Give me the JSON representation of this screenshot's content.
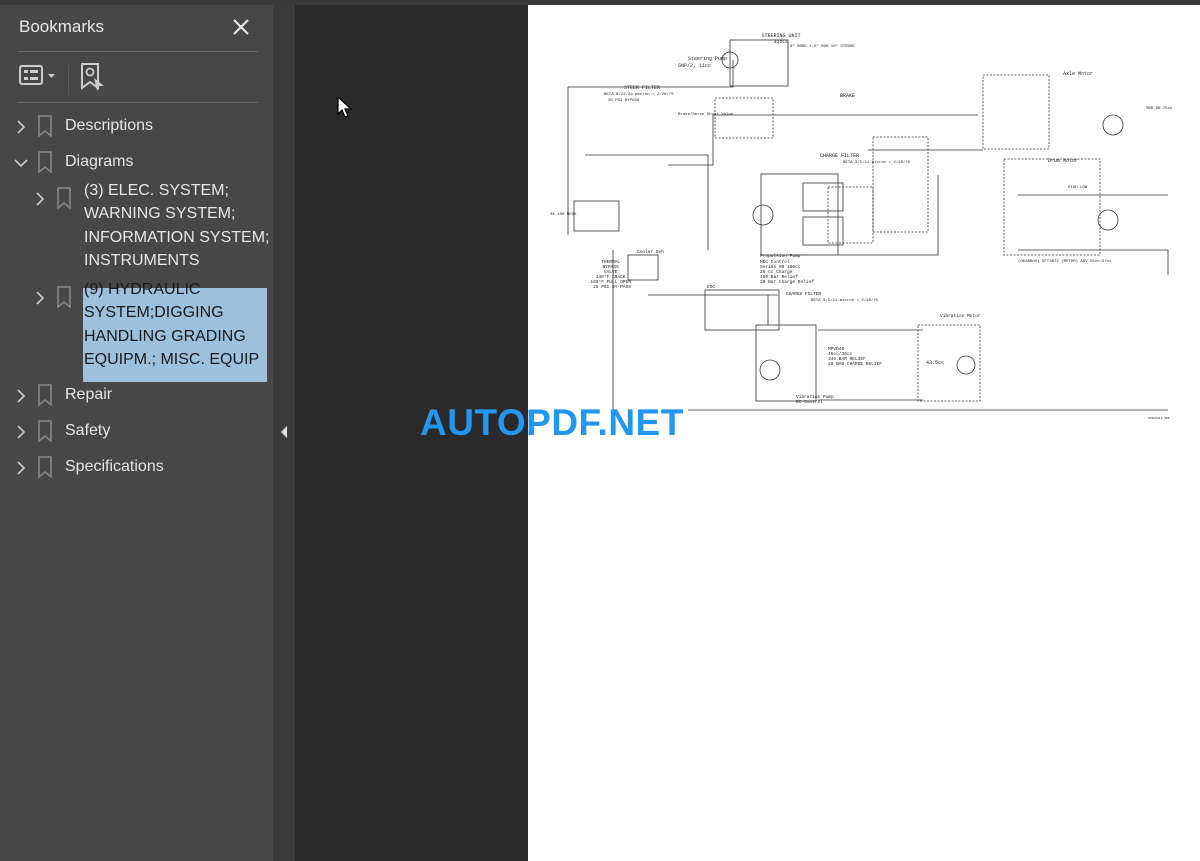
{
  "sidebar": {
    "title": "Bookmarks",
    "items": [
      {
        "label": "Descriptions",
        "expanded": false
      },
      {
        "label": "Diagrams",
        "expanded": true,
        "children": [
          {
            "label_lines": [
              "(3) ELEC. SYSTEM;",
              "WARNING SYSTEM;",
              "INFORMATION SYSTEM;",
              "INSTRUMENTS"
            ],
            "selected": false
          },
          {
            "label_lines": [
              "(9) HYDRAULIC",
              "SYSTEM;DIGGING",
              "HANDLING GRADING",
              "EQUIPM.; MISC. EQUIP"
            ],
            "selected": true
          }
        ]
      },
      {
        "label": "Repair",
        "expanded": false
      },
      {
        "label": "Safety",
        "expanded": false
      },
      {
        "label": "Specifications",
        "expanded": false
      }
    ]
  },
  "document": {
    "watermark": "AUTOPDF.NET",
    "diagram_labels": {
      "steering_unit": "STEERING UNIT",
      "steering_cc": "315CC",
      "steering_pump": "Steering Pump",
      "steering_pump_spec": "SNP/2, 11cc",
      "cylinder": "3\" BORE 1.5\" ROD 10\" STROKE",
      "steer_filter": "STEER FILTER",
      "steer_filter_spec": "BETA 9/22/24 micron = 2/20/75",
      "steer_filter_bypass": "25 PSI BYPASS",
      "brake": "BRAKE",
      "brake_valve": "Brake/Serve Shunt Valve",
      "charge_filter": "CHARGE FILTER",
      "charge_filter_spec": "BETA 3/5/11 micron = 2/20/75",
      "axle_motor": "Axle Motor",
      "axle_motor_spec": "SBR 90 75cc",
      "drum_motor": "Drum Motor",
      "high_low": "HIGH LOW",
      "gearbox": "(GEARBOX) SFT3872 (MOTOR) A6V 55cc/27cc",
      "mesh": "3X 100 MESH",
      "propulsion_pump": "Propulsion Pump",
      "propulsion_spec": [
        "MDC Control",
        "Series 90 100cc",
        "26 cc Charge",
        "450 Bar Relief",
        "20 Bar Charge Relief"
      ],
      "thermal_valve": [
        "THERMAL",
        "BYPASS",
        "VALVE",
        "140°F CRACK",
        "185°F FULL OPEN",
        "25 PSI BY-PASS"
      ],
      "cooler": "Cooler Ovh",
      "edc": "EDC",
      "vibration_motor": "Vibration Motor",
      "vibration_pump_spec": [
        "MPVD46",
        "46cc/36cc",
        "345 BAR RELIEF",
        "20 BAR CHARGE RELIEF"
      ],
      "vibration_motor_cc": "43.5cc",
      "vibration_pump": "Vibration Pump",
      "vibration_pump_ctrl": "DC Control",
      "drawing_id": "S0650313_606"
    }
  }
}
